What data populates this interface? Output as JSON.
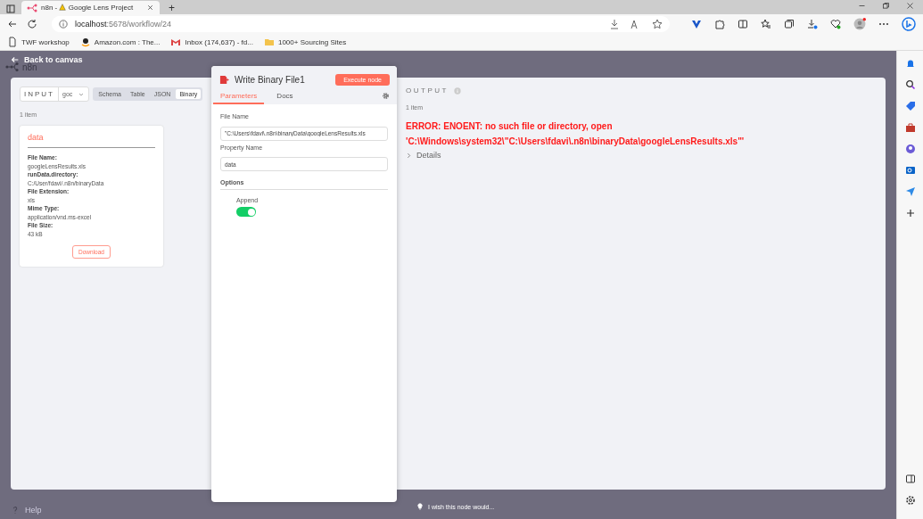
{
  "browser": {
    "tab_prefix": "n8n -",
    "tab_title": "Google Lens Project",
    "new_tab": "+",
    "url_host": "localhost",
    "url_path": ":5678/workflow/24",
    "bookmarks": [
      {
        "kind": "page",
        "label": "TWF workshop"
      },
      {
        "kind": "amazon",
        "label": "Amazon.com : The..."
      },
      {
        "kind": "mail",
        "label": "Inbox (174,637) - fd..."
      },
      {
        "kind": "folder",
        "label": "1000+ Sourcing Sites"
      }
    ]
  },
  "canvas": {
    "back_label": "Back to canvas",
    "logo": "n8n",
    "help": "Help"
  },
  "input": {
    "label": "INPUT",
    "node_select": "goc",
    "views": [
      {
        "label": "Schema",
        "selected": false
      },
      {
        "label": "Table",
        "selected": false
      },
      {
        "label": "JSON",
        "selected": false
      },
      {
        "label": "Binary",
        "selected": true
      }
    ],
    "count": "1 item",
    "binary": {
      "title": "data",
      "fields": [
        {
          "label": "File Name:",
          "value": "googleLensResults.xls"
        },
        {
          "label": "runData.directory:",
          "value": "C:/User/fdavi/.n8n/binaryData"
        },
        {
          "label": "File Extension:",
          "value": "xls"
        },
        {
          "label": "Mime Type:",
          "value": "application/vnd.ms-excel"
        },
        {
          "label": "File Size:",
          "value": "43 kB"
        }
      ],
      "download": "Download"
    }
  },
  "node": {
    "title": "Write Binary File1",
    "execute": "Execute node",
    "tabs": [
      {
        "label": "Parameters",
        "selected": true
      },
      {
        "label": "Docs",
        "selected": false
      }
    ],
    "params": [
      {
        "label": "File Name",
        "value": "\"C:\\Users\\fdavi\\.n8n\\binaryData\\googleLensResults.xls"
      },
      {
        "label": "Property Name",
        "value": "data"
      }
    ],
    "options_label": "Options",
    "append": {
      "label": "Append",
      "on": true
    },
    "feedback": "I wish this node would..."
  },
  "output": {
    "label": "OUTPUT",
    "count": "1 item",
    "error_lines": [
      "ERROR: ENOENT: no such file or directory, open",
      "'C:\\Windows\\system32\\\"C:\\Users\\fdavi\\.n8n\\binaryData\\googleLensResults.xls\"'"
    ],
    "details": "Details"
  }
}
